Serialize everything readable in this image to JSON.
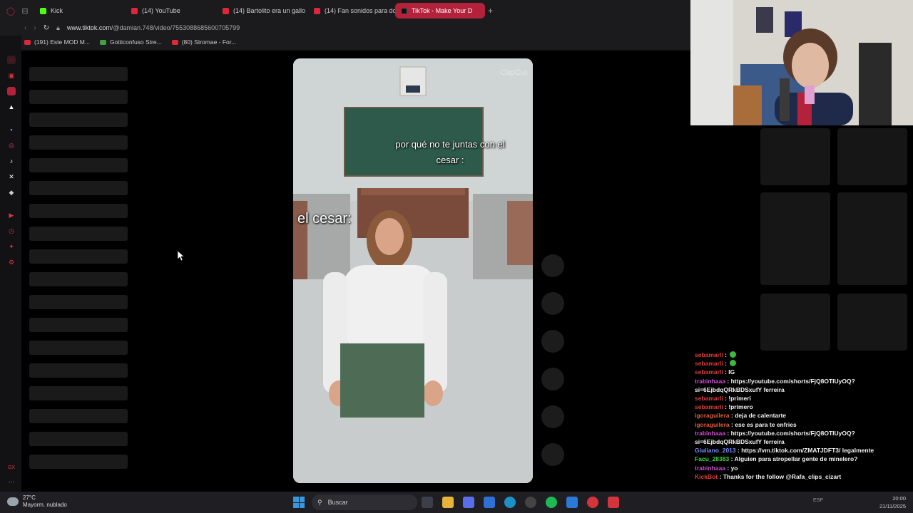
{
  "tabs": [
    {
      "label": "Kick",
      "icon": "kick-icon"
    },
    {
      "label": "(14) YouTube",
      "icon": "youtube-icon"
    },
    {
      "label": "(14) Bartolito era un gallo",
      "icon": "youtube-icon"
    },
    {
      "label": "(14) Fan sonidos para do",
      "icon": "youtube-icon"
    },
    {
      "label": "TikTok - Make Your D",
      "icon": "tiktok-icon",
      "active": true
    }
  ],
  "address": {
    "host": "www.tiktok.com",
    "path": "/@damian.748/video/7553088685600705799"
  },
  "bookmarks": [
    {
      "label": "(191) Este MOD M...",
      "icon": "youtube-icon"
    },
    {
      "label": "Gotticonfuso Stre...",
      "icon": "github-icon"
    },
    {
      "label": "(80) Stromae - For...",
      "icon": "youtube-icon"
    }
  ],
  "video": {
    "watermark": "CapCut",
    "caption_top": "por qué no te juntas con el cesar :",
    "caption_name": "el cesar:"
  },
  "chat": [
    {
      "user": "sebamarli",
      "sep": " : ",
      "text": "",
      "emote": true,
      "color": "#e03a3a"
    },
    {
      "user": "sebamarli",
      "sep": " : ",
      "text": "",
      "emote": true,
      "color": "#e03a3a"
    },
    {
      "user": "sebamarli",
      "sep": " : ",
      "text": "IG",
      "color": "#e03a3a"
    },
    {
      "user": "trabinhaaa",
      "sep": " : ",
      "text": "https://youtube.com/shorts/FjQ8OTIUyOQ?si=6EjbdqQRkBDSxufY ferreira",
      "color": "#d14bd1"
    },
    {
      "user": "sebamarli",
      "sep": " : ",
      "text": "!primeri",
      "color": "#e03a3a"
    },
    {
      "user": "sebamarli",
      "sep": " : ",
      "text": "!primero",
      "color": "#e03a3a"
    },
    {
      "user": "igoraguilera",
      "sep": " : ",
      "text": "deja de calentarte",
      "color": "#e05c3a"
    },
    {
      "user": "igoraguilera",
      "sep": " : ",
      "text": "ese es para te enfries",
      "color": "#e05c3a"
    },
    {
      "user": "trabinhaaa",
      "sep": " : ",
      "text": "https://youtube.com/shorts/FjQ8OTIUyOQ?si=6EjbdqQRkBDSxufY ferreira",
      "color": "#d14bd1"
    },
    {
      "user": "Giuliano_2013",
      "sep": " : ",
      "text": "https://vm.tiktok.com/ZMATJDFT3/ legalmente",
      "color": "#7a8cff"
    },
    {
      "user": "Facu_28383",
      "sep": " : ",
      "text": "Alguien para atropellar gente de minelero?",
      "color": "#3cd63c"
    },
    {
      "user": "trabinhaaa",
      "sep": " : ",
      "text": "yo",
      "color": "#d14bd1"
    },
    {
      "user": "KickBot",
      "sep": " : ",
      "text": "Thanks for the follow @Rafa_clips_cizart",
      "color": "#e03a3a"
    }
  ],
  "taskbar": {
    "weather_temp": "27°C",
    "weather_desc": "Mayorm. nublado",
    "search_placeholder": "Buscar",
    "lang": "ESP",
    "time": "20:00",
    "date": "21/11/2025"
  },
  "colors": {
    "accent": "#b3213a",
    "tab_active": "#b3213a",
    "taskbar": "#1f1f23"
  }
}
